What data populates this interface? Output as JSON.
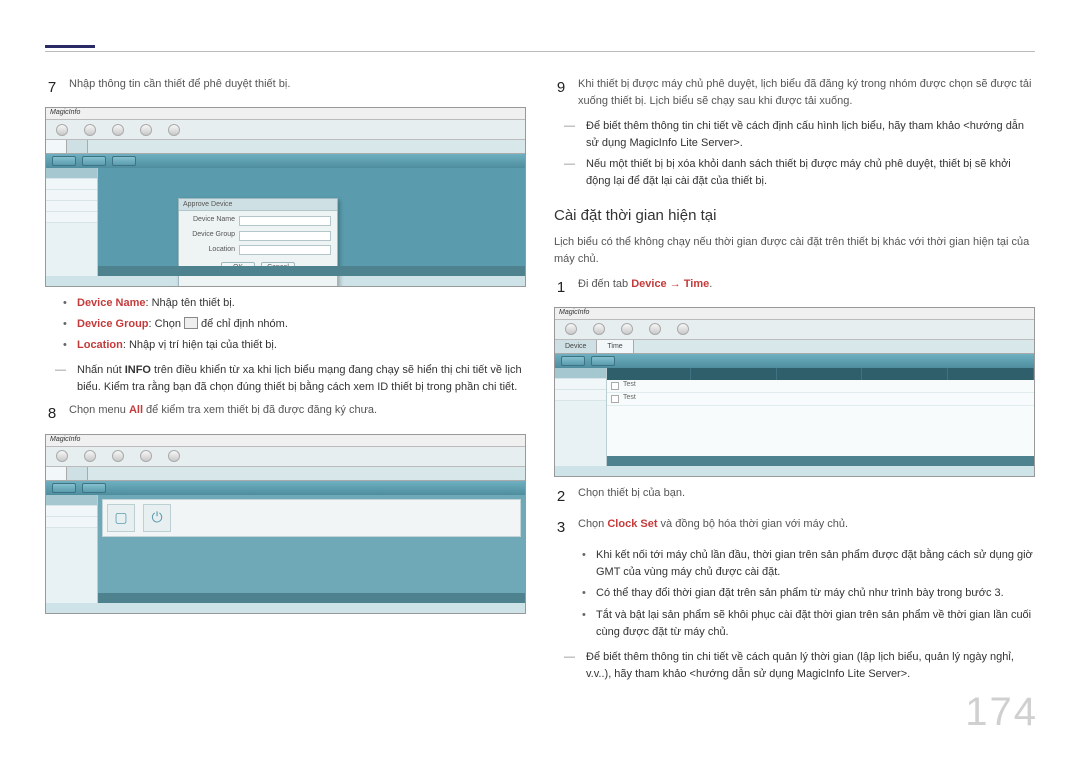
{
  "page_number": "174",
  "left": {
    "step7": {
      "num": "7",
      "text": "Nhập thông tin cần thiết để phê duyệt thiết bị."
    },
    "bullets": {
      "device_name_label": "Device Name",
      "device_name_text": ": Nhập tên thiết bị.",
      "device_group_label": "Device Group",
      "device_group_text_a": ": Chọn ",
      "device_group_text_b": " để chỉ định nhóm.",
      "location_label": "Location",
      "location_text": ": Nhập vị trí hiện tại của thiết bị."
    },
    "dash_note": {
      "pre": "Nhấn nút ",
      "info": "INFO",
      "post": " trên điều khiển từ xa khi lịch biểu mạng đang chạy sẽ hiển thị chi tiết về lịch biểu. Kiểm tra rằng bạn đã chọn đúng thiết bị bằng cách xem ID thiết bị trong phần chi tiết."
    },
    "step8": {
      "num": "8",
      "pre": "Chọn menu ",
      "all": "All",
      "post": " để kiểm tra xem thiết bị đã được đăng ký chưa."
    }
  },
  "right": {
    "step9": {
      "num": "9",
      "text": "Khi thiết bị được máy chủ phê duyệt, lịch biểu đã đăng ký trong nhóm được chọn sẽ được tải xuống thiết bị. Lịch biểu sẽ chạy sau khi được tải xuống."
    },
    "dash1": "Để biết thêm thông tin chi tiết về cách định cấu hình lịch biểu, hãy tham khảo <hướng dẫn sử dụng MagicInfo Lite Server>.",
    "dash2": "Nếu một thiết bị bị xóa khỏi danh sách thiết bị được máy chủ phê duyệt, thiết bị sẽ khởi động lại để đặt lại cài đặt của thiết bị.",
    "heading": "Cài đặt thời gian hiện tại",
    "intro": "Lịch biểu có thể không chạy nếu thời gian được cài đặt trên thiết bị khác với thời gian hiện tại của máy chủ.",
    "step1": {
      "num": "1",
      "pre": "Đi đến tab ",
      "path": "Device → Time",
      "post": "."
    },
    "step2": {
      "num": "2",
      "text": "Chọn thiết bị của bạn."
    },
    "step3": {
      "num": "3",
      "pre": "Chọn ",
      "clock": "Clock Set",
      "post": " và đồng bộ hóa thời gian với máy chủ."
    },
    "sub_bullets": {
      "b1": "Khi kết nối tới máy chủ lần đầu, thời gian trên sản phẩm được đặt bằng cách sử dụng giờ GMT của vùng máy chủ được cài đặt.",
      "b2": "Có thể thay đổi thời gian đặt trên sản phẩm từ máy chủ như trình bày trong bước 3.",
      "b3": "Tắt và bật lại sản phẩm sẽ khôi phục cài đặt thời gian trên sản phẩm về thời gian lần cuối cùng được đặt từ máy chủ."
    },
    "dash3": "Để biết thêm thông tin chi tiết về cách quản lý thời gian (lập lịch biểu, quản lý ngày nghỉ, v.v..), hãy tham khảo <hướng dẫn sử dụng MagicInfo Lite Server>."
  },
  "shots": {
    "logo": "MagicInfo",
    "modal": {
      "title": "Approve Device",
      "device_name": "Device Name",
      "device_group": "Device Group",
      "location": "Location",
      "ok": "OK",
      "cancel": "Cancel"
    },
    "tabs": {
      "device": "Device",
      "time": "Time"
    },
    "list_row": "Test"
  }
}
